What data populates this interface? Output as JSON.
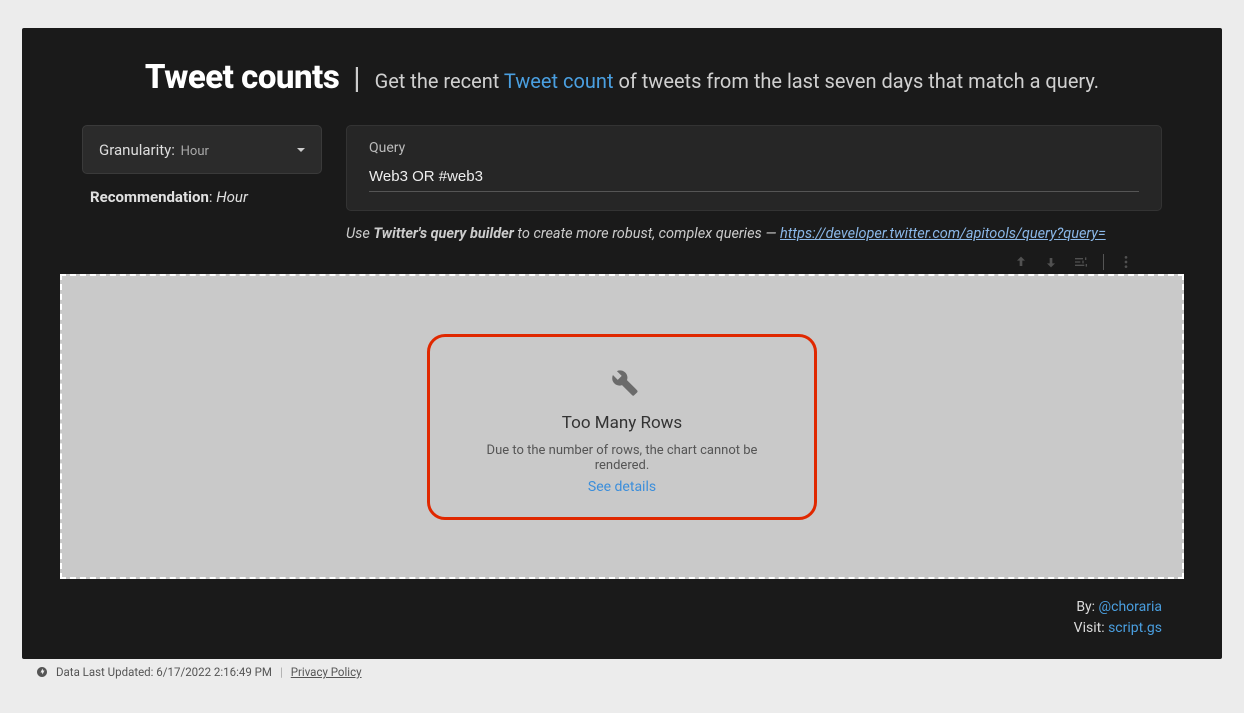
{
  "header": {
    "title": "Tweet counts",
    "subtitle_pre": "Get the recent ",
    "subtitle_link": "Tweet count",
    "subtitle_post": " of tweets from the last seven days that match a query."
  },
  "granularity": {
    "label": "Granularity",
    "value": "Hour"
  },
  "recommendation": {
    "label": "Recommendation",
    "value": "Hour"
  },
  "query": {
    "label": "Query",
    "value": "Web3 OR #web3"
  },
  "hint": {
    "pre": "Use ",
    "bold": "Twitter's query builder",
    "mid": " to create more robust, complex queries — ",
    "url": "https://developer.twitter.com/apitools/query?query="
  },
  "chart_error": {
    "title": "Too Many Rows",
    "message": "Due to the number of rows, the chart cannot be rendered.",
    "link": "See details"
  },
  "footer": {
    "by_label": "By: ",
    "by_handle": "@choraria",
    "visit_label": "Visit: ",
    "visit_link": "script.gs"
  },
  "status": {
    "updated": "Data Last Updated: 6/17/2022 2:16:49 PM",
    "privacy": "Privacy Policy"
  }
}
